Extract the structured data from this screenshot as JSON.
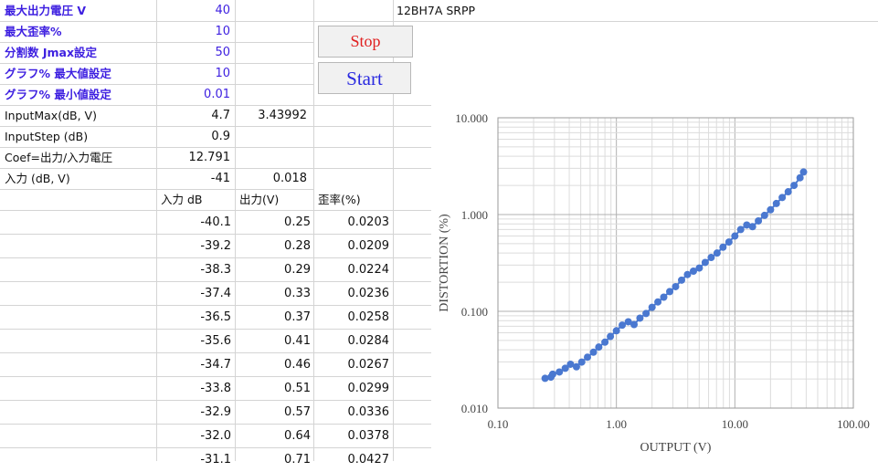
{
  "params": [
    {
      "label": "最大出力電圧 V",
      "value": "40"
    },
    {
      "label": "最大歪率%",
      "value": "10"
    },
    {
      "label": "分割数 Jmax設定",
      "value": "50"
    },
    {
      "label": "グラフ% 最大値設定",
      "value": "10"
    },
    {
      "label": "グラフ% 最小値設定",
      "value": "0.01"
    }
  ],
  "info_rows": [
    {
      "label": "InputMax(dB, V)",
      "value": "4.7",
      "value2": "3.43992"
    },
    {
      "label": "InputStep (dB)",
      "value": "0.9",
      "value2": ""
    },
    {
      "label": "Coef=出力/入力電圧",
      "value": "12.791",
      "value2": ""
    },
    {
      "label": "入力 (dB, V)",
      "value": "-41",
      "value2": "0.018"
    }
  ],
  "title_cell": "12BH7A SRPP",
  "buttons": {
    "stop": "Stop",
    "start": "Start"
  },
  "table": {
    "headers": [
      "入力 dB",
      "出力(V)",
      "歪率(%)"
    ],
    "rows": [
      [
        "-40.1",
        "0.25",
        "0.0203"
      ],
      [
        "-39.2",
        "0.28",
        "0.0209"
      ],
      [
        "-38.3",
        "0.29",
        "0.0224"
      ],
      [
        "-37.4",
        "0.33",
        "0.0236"
      ],
      [
        "-36.5",
        "0.37",
        "0.0258"
      ],
      [
        "-35.6",
        "0.41",
        "0.0284"
      ],
      [
        "-34.7",
        "0.46",
        "0.0267"
      ],
      [
        "-33.8",
        "0.51",
        "0.0299"
      ],
      [
        "-32.9",
        "0.57",
        "0.0336"
      ],
      [
        "-32.0",
        "0.64",
        "0.0378"
      ],
      [
        "-31.1",
        "0.71",
        "0.0427"
      ]
    ]
  },
  "chart_data": {
    "type": "scatter",
    "xlabel": "OUTPUT (V)",
    "ylabel": "DISTORTION (%)",
    "x_scale": "log",
    "y_scale": "log",
    "xlim": [
      0.1,
      100
    ],
    "ylim": [
      0.01,
      10
    ],
    "xticks": [
      "0.10",
      "1.00",
      "10.00",
      "100.00"
    ],
    "yticks": [
      "0.010",
      "0.100",
      "1.000",
      "10.000"
    ],
    "grid": true,
    "marker_color": "#4a78d0",
    "line_color": "#4a78d0",
    "series": [
      {
        "x": [
          0.25,
          0.28,
          0.29,
          0.33,
          0.37,
          0.41,
          0.46,
          0.51,
          0.57,
          0.64,
          0.71,
          0.8,
          0.89,
          1.0,
          1.12,
          1.26,
          1.41,
          1.58,
          1.78,
          2.0,
          2.24,
          2.51,
          2.82,
          3.16,
          3.55,
          3.98,
          4.47,
          5.01,
          5.62,
          6.31,
          7.08,
          7.94,
          8.91,
          10.0,
          11.2,
          12.6,
          14.1,
          15.8,
          17.8,
          20.0,
          22.4,
          25.1,
          28.2,
          31.6,
          35.5,
          38.0
        ],
        "y": [
          0.0203,
          0.0209,
          0.0224,
          0.0236,
          0.0258,
          0.0284,
          0.0267,
          0.0299,
          0.0336,
          0.0378,
          0.0427,
          0.048,
          0.055,
          0.063,
          0.072,
          0.078,
          0.073,
          0.085,
          0.095,
          0.11,
          0.125,
          0.14,
          0.16,
          0.18,
          0.21,
          0.24,
          0.26,
          0.28,
          0.32,
          0.36,
          0.4,
          0.46,
          0.52,
          0.6,
          0.7,
          0.78,
          0.75,
          0.86,
          0.98,
          1.12,
          1.3,
          1.5,
          1.72,
          2.0,
          2.4,
          2.75
        ]
      }
    ]
  }
}
